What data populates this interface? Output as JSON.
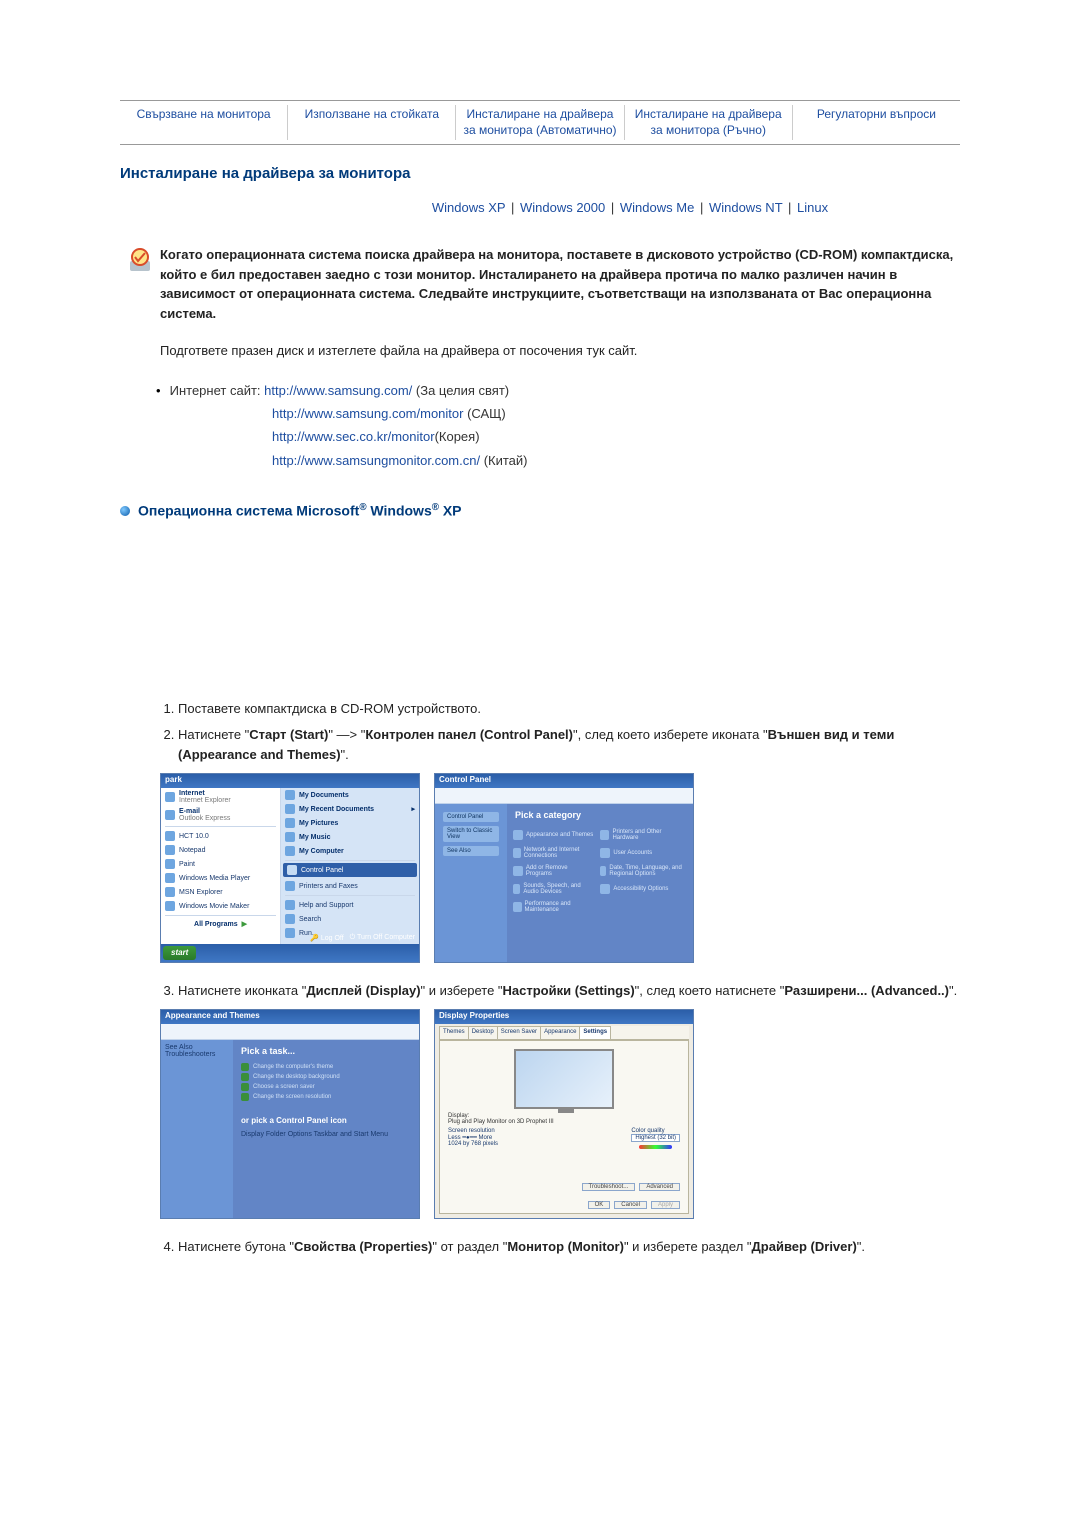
{
  "tabs": [
    "Свързване на монитора",
    "Използване на стойката",
    "Инсталиране на драйвера за монитора (Автоматично)",
    "Инсталиране на драйвера за монитора (Ръчно)",
    "Регулаторни въпроси"
  ],
  "section_title": "Инсталиране на драйвера за монитора",
  "os_links": {
    "items": [
      "Windows XP",
      "Windows 2000",
      "Windows Me",
      "Windows NT",
      "Linux"
    ]
  },
  "intro": "Когато операционната система поиска драйвера на монитора, поставете в дисковото устройство (CD-ROM) компактдиска, който е бил предоставен заедно с този монитор. Инсталирането на драйвера протича по малко различен начин в зависимост от операционната система. Следвайте инструкциите, съответстващи на използваната от Вас операционна система.",
  "prep_text": "Подгответе празен диск и изтеглете файла на драйвера от посочения тук сайт.",
  "internet": {
    "label": "Интернет сайт:",
    "lines": [
      {
        "url": "http://www.samsung.com/",
        "suffix": " (За целия свят)"
      },
      {
        "url": "http://www.samsung.com/monitor",
        "suffix": " (САЩ)"
      },
      {
        "url": "http://www.sec.co.kr/monitor",
        "suffix": "(Корея)"
      },
      {
        "url": "http://www.samsungmonitor.com.cn/",
        "suffix": " (Китай)"
      }
    ]
  },
  "os_heading": "Операционна система Microsoft® Windows® XP",
  "steps": {
    "s1": "Поставете компактдиска в CD-ROM устройството.",
    "s2_a": "Натиснете \"",
    "s2_b": "Старт (Start)",
    "s2_c": "\" —> \"",
    "s2_d": "Контролен панел (Control Panel)",
    "s2_e": "\", след което изберете иконата \"",
    "s2_f": "Външен вид и теми (Appearance and Themes)",
    "s2_g": "\".",
    "s3_a": "Натиснете иконката \"",
    "s3_b": "Дисплей (Display)",
    "s3_c": "\" и изберете \"",
    "s3_d": "Настройки (Settings)",
    "s3_e": "\", след което натиснете \"",
    "s3_f": "Разширени... (Advanced..)",
    "s3_g": "\".",
    "s4_a": "Натиснете бутона \"",
    "s4_b": "Свойства (Properties)",
    "s4_c": "\" от раздел \"",
    "s4_d": "Монитор (Monitor)",
    "s4_e": "\" и изберете раздел \"",
    "s4_f": "Драйвер (Driver)",
    "s4_g": "\"."
  },
  "startmenu": {
    "title": "park",
    "left": [
      {
        "l1": "Internet",
        "l2": "Internet Explorer"
      },
      {
        "l1": "E-mail",
        "l2": "Outlook Express"
      },
      {
        "l1": "HCT 10.0"
      },
      {
        "l1": "Notepad"
      },
      {
        "l1": "Paint"
      },
      {
        "l1": "Windows Media Player"
      },
      {
        "l1": "MSN Explorer"
      },
      {
        "l1": "Windows Movie Maker"
      }
    ],
    "all_programs": "All Programs",
    "right": [
      "My Documents",
      "My Recent Documents",
      "My Pictures",
      "My Music",
      "My Computer",
      "Control Panel",
      "Printers and Faxes",
      "Help and Support",
      "Search",
      "Run..."
    ],
    "logoff": "Log Off",
    "turnoff": "Turn Off Computer",
    "start": "start"
  },
  "controlpanel": {
    "title": "Control Panel",
    "pick": "Pick a category",
    "cats": [
      "Appearance and Themes",
      "Printers and Other Hardware",
      "Network and Internet Connections",
      "User Accounts",
      "Add or Remove Programs",
      "Date, Time, Language, and Regional Options",
      "Sounds, Speech, and Audio Devices",
      "Accessibility Options",
      "Performance and Maintenance"
    ],
    "see_also": "See Also",
    "switch": "Switch to Classic View"
  },
  "appthemes": {
    "title": "Appearance and Themes",
    "pick": "Pick a task...",
    "tasks": [
      "Change the computer's theme",
      "Change the desktop background",
      "Choose a screen saver",
      "Change the screen resolution"
    ],
    "or_pick": "or pick a Control Panel icon",
    "icons": [
      "Display",
      "Folder Options",
      "Taskbar and Start Menu"
    ],
    "see_also": "See Also",
    "troubleshooters": "Troubleshooters"
  },
  "displayprops": {
    "title": "Display Properties",
    "tabs": [
      "Themes",
      "Desktop",
      "Screen Saver",
      "Appearance",
      "Settings"
    ],
    "display_lbl": "Display:",
    "display_val": "Plug and Play Monitor on 3D Prophet III",
    "res_lbl": "Screen resolution",
    "less": "Less",
    "more": "More",
    "res_val": "1024 by 768 pixels",
    "cq_lbl": "Color quality",
    "cq_val": "Highest (32 bit)",
    "btn_trouble": "Troubleshoot...",
    "btn_adv": "Advanced",
    "btn_ok": "OK",
    "btn_cancel": "Cancel",
    "btn_apply": "Apply"
  }
}
